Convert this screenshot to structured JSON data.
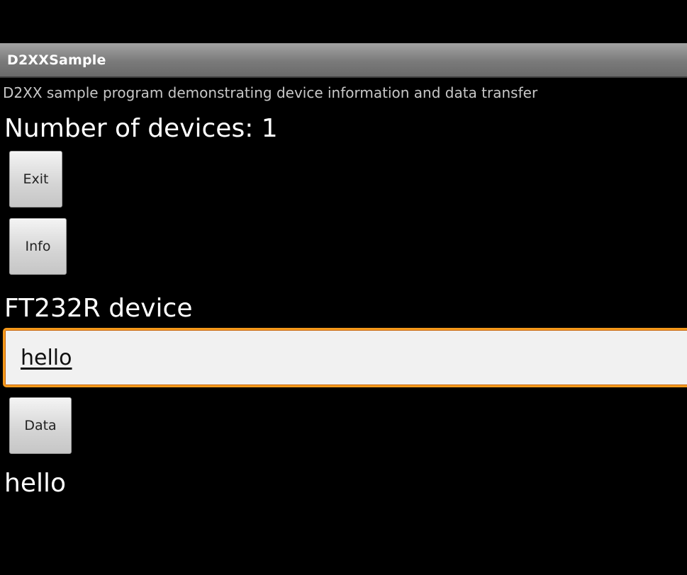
{
  "app": {
    "title": "D2XXSample",
    "description": "D2XX sample program demonstrating device information and data transfer"
  },
  "device_count_label": "Number of devices: 1",
  "buttons": {
    "exit": "Exit",
    "info": "Info",
    "data": "Data"
  },
  "device_name": "FT232R device",
  "input": {
    "value": "hello"
  },
  "received_text": "hello",
  "colors": {
    "background": "#000000",
    "title_bar": "#8a8a8a",
    "focus_border": "#f59a1c"
  }
}
